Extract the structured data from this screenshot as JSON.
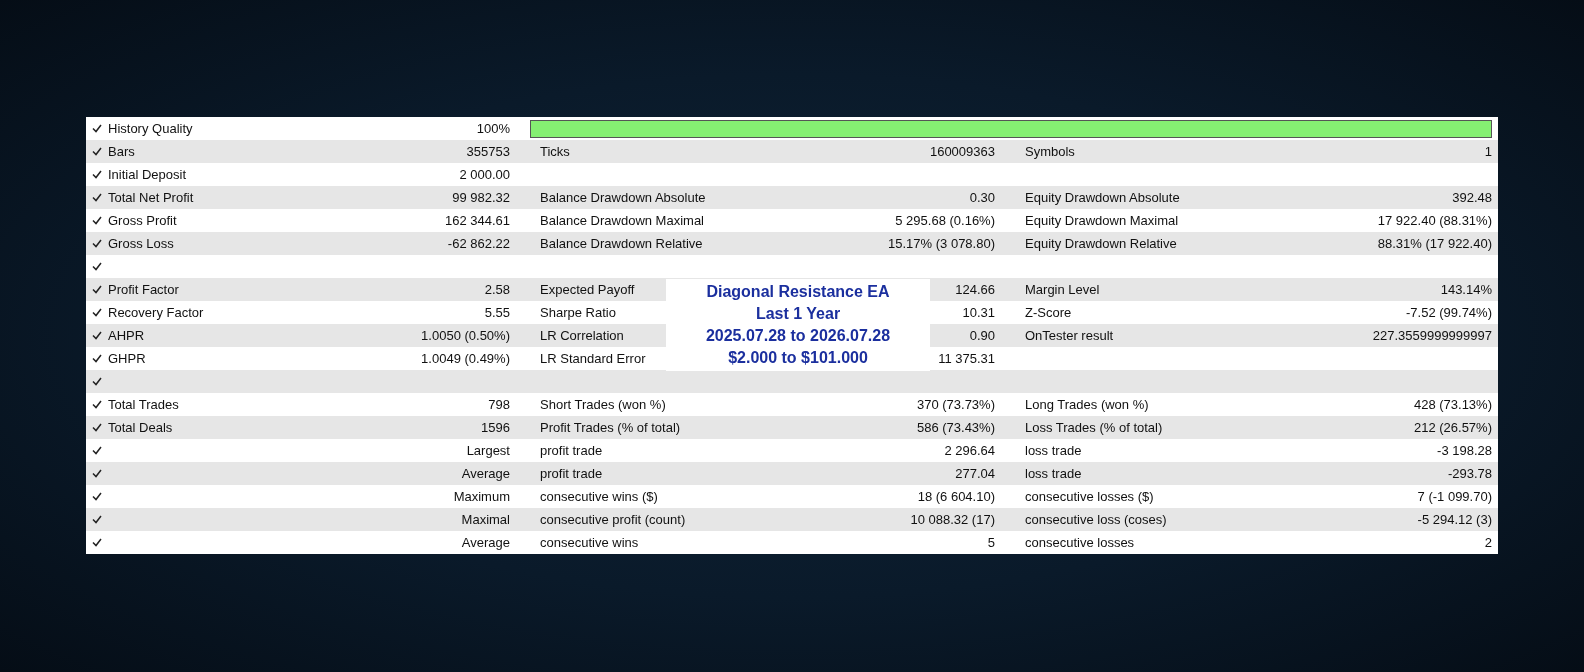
{
  "report": {
    "rows": [
      {
        "kind": "quality",
        "checked": true,
        "label": "History Quality",
        "value": "100%",
        "level": 1
      },
      {
        "kind": "stat",
        "checked": true,
        "label": "Bars",
        "value": "355753",
        "label_2": "Ticks",
        "value_2": "160009363",
        "label_3": "Symbols",
        "value_3": "1"
      },
      {
        "kind": "stat",
        "checked": true,
        "label": "Initial Deposit",
        "value": "2 000.00"
      },
      {
        "kind": "stat",
        "checked": true,
        "label": "Total Net Profit",
        "value": "99 982.32",
        "label_2": "Balance Drawdown Absolute",
        "value_2": "0.30",
        "label_3": "Equity Drawdown Absolute",
        "value_3": "392.48"
      },
      {
        "kind": "stat",
        "checked": true,
        "label": "Gross Profit",
        "value": "162 344.61",
        "label_2": "Balance Drawdown Maximal",
        "value_2": "5 295.68 (0.16%)",
        "label_3": "Equity Drawdown Maximal",
        "value_3": "17 922.40 (88.31%)"
      },
      {
        "kind": "stat",
        "checked": true,
        "label": "Gross Loss",
        "value": "-62 862.22",
        "label_2": "Balance Drawdown Relative",
        "value_2": "15.17% (3 078.80)",
        "label_3": "Equity Drawdown Relative",
        "value_3": "88.31% (17 922.40)"
      },
      {
        "kind": "stat",
        "checked": true
      },
      {
        "kind": "stat",
        "checked": true,
        "label": "Profit Factor",
        "value": "2.58",
        "label_2": "Expected Payoff",
        "value_2": "124.66",
        "label_3": "Margin Level",
        "value_3": "143.14%"
      },
      {
        "kind": "stat",
        "checked": true,
        "label": "Recovery Factor",
        "value": "5.55",
        "label_2": "Sharpe Ratio",
        "value_2": "10.31",
        "label_3": "Z-Score",
        "value_3": "-7.52 (99.74%)"
      },
      {
        "kind": "stat",
        "checked": true,
        "label": "AHPR",
        "value": "1.0050 (0.50%)",
        "label_2": "LR Correlation",
        "value_2": "0.90",
        "label_3": "OnTester result",
        "value_3": "227.3559999999997"
      },
      {
        "kind": "stat",
        "checked": true,
        "label": "GHPR",
        "value": "1.0049 (0.49%)",
        "label_2": "LR Standard Error",
        "value_2": "11 375.31"
      },
      {
        "kind": "stat",
        "checked": true
      },
      {
        "kind": "stat",
        "checked": true,
        "label": "Total Trades",
        "value": "798",
        "label_2": "Short Trades (won %)",
        "value_2": "370 (73.73%)",
        "label_3": "Long Trades (won %)",
        "value_3": "428 (73.13%)"
      },
      {
        "kind": "stat",
        "checked": true,
        "label": "Total Deals",
        "value": "1596",
        "label_2": "Profit Trades (% of total)",
        "value_2": "586 (73.43%)",
        "label_3": "Loss Trades (% of total)",
        "value_3": "212 (26.57%)"
      },
      {
        "kind": "stat",
        "checked": true,
        "value": "Largest",
        "label_2": "profit trade",
        "value_2": "2 296.64",
        "label_3": "loss trade",
        "value_3": "-3 198.28"
      },
      {
        "kind": "stat",
        "checked": true,
        "value": "Average",
        "label_2": "profit trade",
        "value_2": "277.04",
        "label_3": "loss trade",
        "value_3": "-293.78"
      },
      {
        "kind": "stat",
        "checked": true,
        "value": "Maximum",
        "label_2": "consecutive wins ($)",
        "value_2": "18 (6 604.10)",
        "label_3": "consecutive losses ($)",
        "value_3": "7 (-1 099.70)"
      },
      {
        "kind": "stat",
        "checked": true,
        "value": "Maximal",
        "label_2": "consecutive profit (count)",
        "value_2": "10 088.32 (17)",
        "label_3": "consecutive loss (coses)",
        "value_3": "-5 294.12 (3)"
      },
      {
        "kind": "stat",
        "checked": true,
        "value": "Average",
        "label_2": "consecutive wins",
        "value_2": "5",
        "label_3": "consecutive losses",
        "value_3": "2"
      }
    ]
  },
  "overlay": {
    "lines": [
      "Diagonal Resistance EA",
      "Last 1 Year",
      "2025.07.28 to 2026.07.28",
      "$2.000 to $101.000"
    ]
  }
}
